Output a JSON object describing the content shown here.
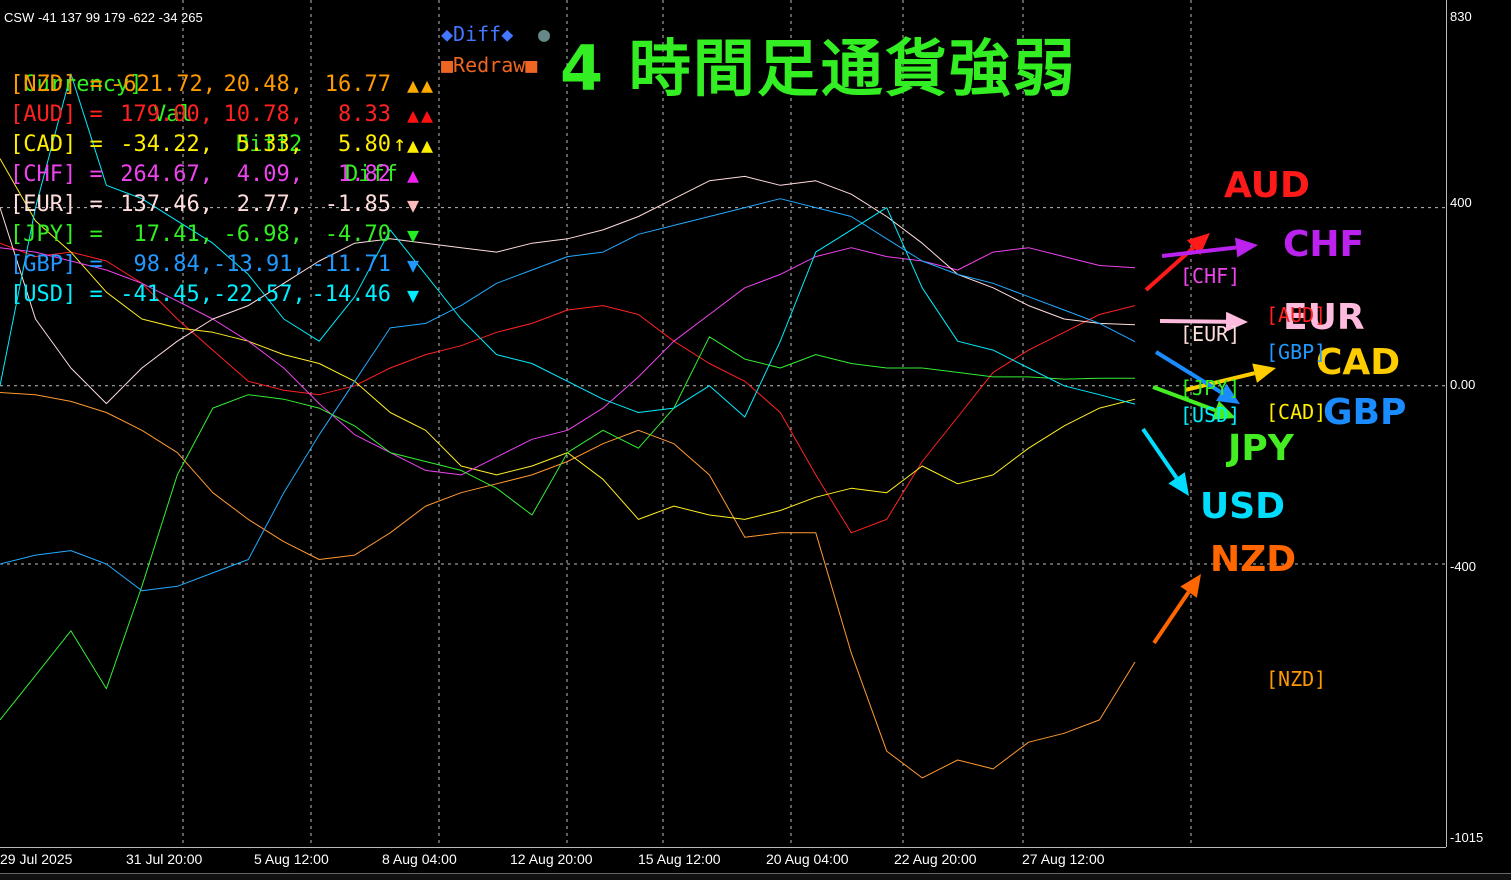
{
  "indicator_title": "CSW -41 137 99 179 -622 -34 265",
  "big_title": "4 時間足通貨強弱",
  "table": {
    "header": {
      "currency": "[Currency]",
      "val": "Val",
      "diff2": "Diff2",
      "diff": "Diff"
    },
    "rows": [
      {
        "name": "[NZD] =",
        "val": "-621.72,",
        "diff2": "20.48,",
        "diff": "16.77",
        "extra": "",
        "arrows": "▲▲",
        "color": "#ff9900",
        "arrow_color": "#ffaa00"
      },
      {
        "name": "[AUD] =",
        "val": "179.00,",
        "diff2": "10.78,",
        "diff": "8.33",
        "extra": "",
        "arrows": "▲▲",
        "color": "#ff2222",
        "arrow_color": "#ff1111"
      },
      {
        "name": "[CAD] =",
        "val": "-34.22,",
        "diff2": "5.33,",
        "diff": "5.80",
        "extra": "↑",
        "arrows": "▲▲",
        "color": "#ffee00",
        "arrow_color": "#ffee00"
      },
      {
        "name": "[CHF] =",
        "val": "264.67,",
        "diff2": "4.09,",
        "diff": "1.82",
        "extra": "",
        "arrows": "▲",
        "color": "#ee44ee",
        "arrow_color": "#ee22ee"
      },
      {
        "name": "[EUR] =",
        "val": "137.46,",
        "diff2": "2.77,",
        "diff": "-1.85",
        "extra": "",
        "arrows": "▼",
        "color": "#ffdddd",
        "arrow_color": "#ffbbbb"
      },
      {
        "name": "[JPY] =",
        "val": "17.41,",
        "diff2": "-6.98,",
        "diff": "-4.70",
        "extra": "",
        "arrows": "▼",
        "color": "#33ee22",
        "arrow_color": "#22ee22"
      },
      {
        "name": "[GBP] =",
        "val": "98.84,",
        "diff2": "-13.91,",
        "diff": "-11.71",
        "extra": "",
        "arrows": "▼",
        "color": "#2299ff",
        "arrow_color": "#2299ff"
      },
      {
        "name": "[USD] =",
        "val": "-41.45,",
        "diff2": "-22.57,",
        "diff": "-14.46",
        "extra": "",
        "arrows": "▼",
        "color": "#00eeff",
        "arrow_color": "#00eeff"
      }
    ]
  },
  "buttons": {
    "diff": "◆Diff◆",
    "diff_dot": "●",
    "redraw": "■Redraw■"
  },
  "colors": {
    "header": "#33ee22",
    "diff_button": "#4477ff",
    "diff_dot": "#668888",
    "redraw_button": "#ee6622",
    "AUD": "#ff1a1a",
    "CHF": "#bb22ee",
    "EUR": "#ffbbdd",
    "CAD": "#ffcc00",
    "GBP": "#1a8cff",
    "JPY": "#44ee22",
    "USD": "#00ddff",
    "NZD": "#ff6600"
  },
  "currency_labels": {
    "AUD": "AUD",
    "CHF": "CHF",
    "EUR": "EUR",
    "CAD": "CAD",
    "GBP": "GBP",
    "JPY": "JPY",
    "USD": "USD",
    "NZD": "NZD"
  },
  "bracket_labels": {
    "CHF": "[CHF]",
    "AUD": "[AUD]",
    "EUR": "[EUR]",
    "GBP": "[GBP]",
    "JPY": "[JPY]",
    "USD": "[USD]",
    "CAD": "[CAD]",
    "NZD": "[NZD]"
  },
  "y_axis": {
    "top": "830",
    "upper": "400",
    "zero": "0.00",
    "lower": "-400",
    "bottom": "-1015"
  },
  "x_axis": [
    "29 Jul 2025",
    "31 Jul 20:00",
    "5 Aug 12:00",
    "8 Aug 04:00",
    "12 Aug 20:00",
    "15 Aug 12:00",
    "20 Aug 04:00",
    "22 Aug 20:00",
    "27 Aug 12:00"
  ],
  "chart_data": {
    "type": "line",
    "ylim": [
      -1015,
      830
    ],
    "series": [
      {
        "name": "NZD",
        "color": "#ff9933",
        "values": [
          -15,
          -20,
          -35,
          -60,
          -100,
          -150,
          -240,
          -300,
          -350,
          -390,
          -380,
          -330,
          -270,
          -240,
          -220,
          -200,
          -170,
          -130,
          -100,
          -130,
          -200,
          -340,
          -330,
          -330,
          -600,
          -820,
          -880,
          -840,
          -860,
          -800,
          -780,
          -750,
          -620
        ]
      },
      {
        "name": "AUD",
        "color": "#ff2222",
        "values": [
          320,
          290,
          300,
          280,
          230,
          150,
          80,
          10,
          -10,
          -20,
          0,
          40,
          70,
          90,
          120,
          140,
          170,
          180,
          160,
          100,
          50,
          10,
          -60,
          -200,
          -330,
          -300,
          -170,
          -70,
          30,
          80,
          120,
          160,
          180
        ]
      },
      {
        "name": "CAD",
        "color": "#ffee22",
        "values": [
          510,
          370,
          300,
          210,
          150,
          130,
          120,
          100,
          70,
          50,
          10,
          -60,
          -100,
          -180,
          -200,
          -180,
          -150,
          -210,
          -300,
          -270,
          -290,
          -300,
          -280,
          -250,
          -230,
          -240,
          -180,
          -220,
          -200,
          -140,
          -90,
          -50,
          -30
        ]
      },
      {
        "name": "CHF",
        "color": "#ee44ee",
        "values": [
          310,
          300,
          280,
          260,
          230,
          190,
          150,
          100,
          40,
          -40,
          -110,
          -150,
          -190,
          -200,
          -160,
          -120,
          -100,
          -50,
          20,
          100,
          160,
          220,
          250,
          290,
          310,
          290,
          280,
          260,
          300,
          310,
          290,
          270,
          265
        ]
      },
      {
        "name": "EUR",
        "color": "#ffdddd",
        "values": [
          400,
          150,
          40,
          -40,
          40,
          100,
          150,
          180,
          230,
          280,
          320,
          330,
          320,
          310,
          300,
          320,
          330,
          350,
          380,
          420,
          460,
          470,
          450,
          460,
          430,
          380,
          320,
          250,
          220,
          180,
          150,
          140,
          137
        ]
      },
      {
        "name": "JPY",
        "color": "#33ee33",
        "values": [
          -750,
          -650,
          -550,
          -680,
          -450,
          -200,
          -50,
          -20,
          -30,
          -50,
          -90,
          -150,
          -170,
          -190,
          -230,
          -290,
          -150,
          -100,
          -140,
          -50,
          110,
          60,
          40,
          70,
          50,
          40,
          40,
          30,
          20,
          20,
          15,
          17,
          17
        ]
      },
      {
        "name": "GBP",
        "color": "#22aaff",
        "values": [
          -400,
          -380,
          -370,
          -400,
          -460,
          -450,
          -420,
          -390,
          -240,
          -110,
          10,
          130,
          140,
          180,
          230,
          260,
          290,
          300,
          340,
          360,
          380,
          400,
          420,
          400,
          380,
          330,
          280,
          250,
          230,
          200,
          170,
          140,
          99
        ]
      },
      {
        "name": "USD",
        "color": "#00eeff",
        "values": [
          0,
          400,
          700,
          450,
          420,
          370,
          320,
          250,
          150,
          100,
          200,
          350,
          250,
          150,
          70,
          50,
          10,
          -30,
          -60,
          -50,
          0,
          -70,
          100,
          300,
          350,
          400,
          220,
          100,
          80,
          40,
          0,
          -20,
          -41
        ]
      }
    ]
  }
}
